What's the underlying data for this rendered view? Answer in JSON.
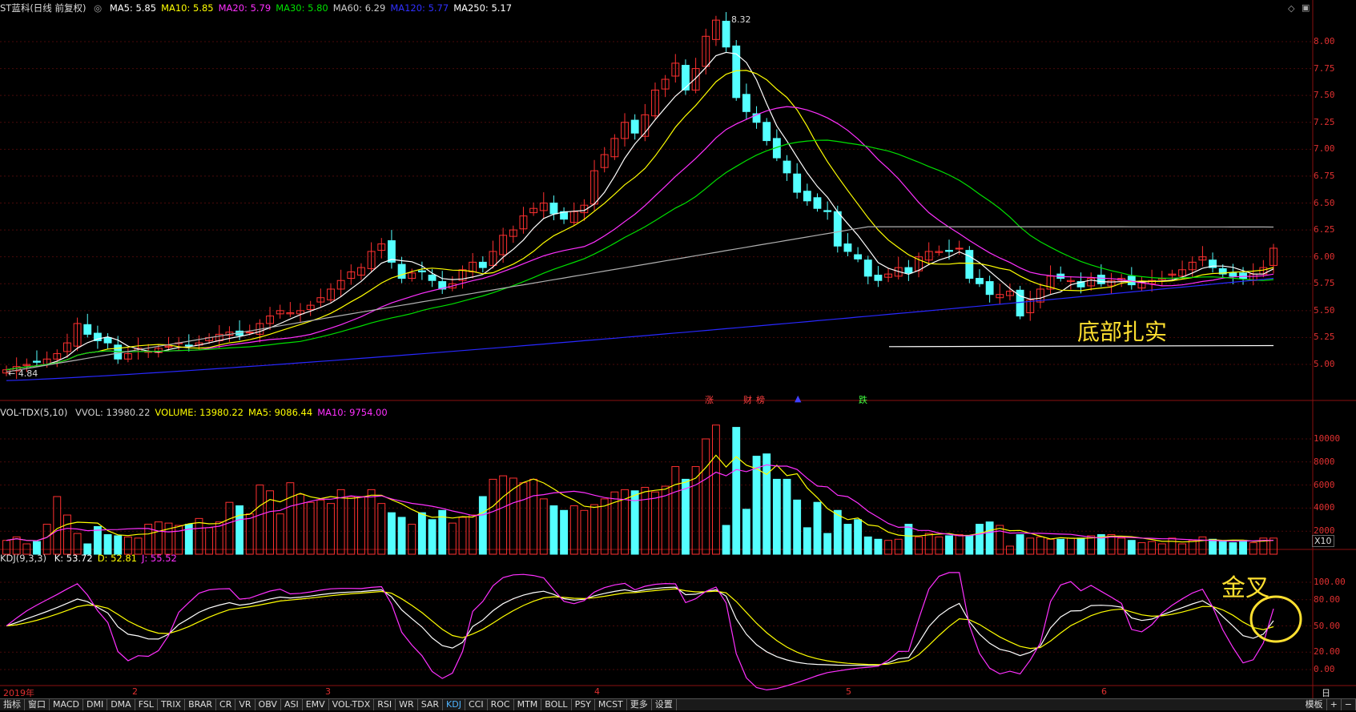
{
  "main": {
    "title": "ST蓝科(日线 前复权)",
    "ma": [
      {
        "label": "MA5: 5.85",
        "color": "#ffffff"
      },
      {
        "label": "MA10: 5.85",
        "color": "#ffff00"
      },
      {
        "label": "MA20: 5.79",
        "color": "#ff30ff"
      },
      {
        "label": "MA30: 5.80",
        "color": "#00e000"
      },
      {
        "label": "MA60: 6.29",
        "color": "#cccccc"
      },
      {
        "label": "MA120: 5.77",
        "color": "#3030ff"
      },
      {
        "label": "MA250: 5.17",
        "color": "#ffffff"
      }
    ],
    "high_label": "8.32",
    "low_label": "4.84",
    "yticks": [
      "8.00",
      "7.75",
      "7.50",
      "7.25",
      "7.00",
      "6.75",
      "6.50",
      "6.25",
      "6.00",
      "5.75",
      "5.50",
      "5.25",
      "5.00"
    ],
    "annotation": "底部扎实",
    "events": [
      {
        "text": "涨",
        "color": "#ff4040"
      },
      {
        "text": "财",
        "color": "#ff4040"
      },
      {
        "text": "榜",
        "color": "#ff4040"
      },
      {
        "text": "▲",
        "color": "#4040ff"
      },
      {
        "text": "跌",
        "color": "#40ff40"
      }
    ]
  },
  "volume": {
    "title": "VOL-TDX(5,10)",
    "items": [
      {
        "label": "VVOL: 13980.22",
        "color": "#cccccc"
      },
      {
        "label": "VOLUME: 13980.22",
        "color": "#ffff00"
      },
      {
        "label": "MA5: 9086.44",
        "color": "#ffff00"
      },
      {
        "label": "MA10: 9754.00",
        "color": "#ff30ff"
      }
    ],
    "yticks": [
      "10000",
      "8000",
      "6000",
      "4000",
      "2000"
    ],
    "unit": "X10"
  },
  "kdj": {
    "title": "KDJ(9,3,3)",
    "items": [
      {
        "label": "K: 53.72",
        "color": "#ffffff"
      },
      {
        "label": "D: 52.81",
        "color": "#ffff00"
      },
      {
        "label": "J: 55.52",
        "color": "#ff30ff"
      }
    ],
    "yticks": [
      "100.00",
      "80.00",
      "50.00",
      "20.00",
      "0.00"
    ],
    "annotation": "金叉"
  },
  "dates": [
    "2019年",
    "2",
    "3",
    "4",
    "5",
    "6"
  ],
  "right_header": "日线",
  "tabs": [
    "指标",
    "窗口",
    "MACD",
    "DMI",
    "DMA",
    "FSL",
    "TRIX",
    "BRAR",
    "CR",
    "VR",
    "OBV",
    "ASI",
    "EMV",
    "VOL-TDX",
    "RSI",
    "WR",
    "SAR",
    "KDJ",
    "CCI",
    "ROC",
    "MTM",
    "BOLL",
    "PSY",
    "MCST",
    "更多",
    "设置"
  ],
  "active_tab": "KDJ",
  "right_tabs": [
    "模板",
    "+",
    "−"
  ],
  "chart_data": {
    "type": "candlestick",
    "closes": [
      4.95,
      4.98,
      5.0,
      5.02,
      5.05,
      5.1,
      5.2,
      5.38,
      5.28,
      5.22,
      5.2,
      5.05,
      5.1,
      5.15,
      5.12,
      5.15,
      5.17,
      5.2,
      5.18,
      5.2,
      5.25,
      5.28,
      5.3,
      5.27,
      5.3,
      5.38,
      5.45,
      5.5,
      5.48,
      5.5,
      5.55,
      5.62,
      5.7,
      5.78,
      5.86,
      5.9,
      6.05,
      6.12,
      5.95,
      5.8,
      5.85,
      5.86,
      5.78,
      5.7,
      5.75,
      5.88,
      5.95,
      5.9,
      6.05,
      6.2,
      6.25,
      6.38,
      6.45,
      6.5,
      6.4,
      6.35,
      6.42,
      6.48,
      6.8,
      6.95,
      7.1,
      7.25,
      7.15,
      7.32,
      7.55,
      7.65,
      7.8,
      7.55,
      7.75,
      8.05,
      8.2,
      7.95,
      7.48,
      7.35,
      7.25,
      7.08,
      6.92,
      6.78,
      6.6,
      6.52,
      6.45,
      6.42,
      6.1,
      6.05,
      5.98,
      5.82,
      5.78,
      5.84,
      5.9,
      5.85,
      6.0,
      6.05,
      6.05,
      6.05,
      6.08,
      5.8,
      5.75,
      5.65,
      5.65,
      5.68,
      5.45,
      5.6,
      5.7,
      5.82,
      5.8,
      5.78,
      5.72,
      5.8,
      5.75,
      5.78,
      5.8,
      5.74,
      5.76,
      5.78,
      5.8,
      5.84,
      5.88,
      5.95,
      6.0,
      5.9,
      5.84,
      5.82,
      5.8,
      5.84,
      5.9,
      6.08
    ],
    "volumes": [
      1200,
      1500,
      900,
      1100,
      2600,
      5000,
      3400,
      1800,
      900,
      2400,
      1700,
      1600,
      1500,
      1400,
      2600,
      2800,
      2700,
      2500,
      2600,
      3100,
      2300,
      2800,
      4500,
      4200,
      3500,
      6000,
      5500,
      3500,
      6200,
      5200,
      4500,
      4700,
      4400,
      5600,
      5000,
      5000,
      5600,
      4400,
      3600,
      3200,
      2600,
      3600,
      3000,
      3800,
      2700,
      3200,
      3400,
      5000,
      6500,
      6800,
      6600,
      6200,
      6500,
      4800,
      4200,
      3800,
      4200,
      3800,
      4300,
      4800,
      5400,
      5600,
      5500,
      5800,
      5400,
      5900,
      7600,
      6500,
      7600,
      10000,
      11200,
      2500,
      11000,
      3900,
      8500,
      8700,
      6500,
      6500,
      4700,
      2300,
      4500,
      1800,
      3800,
      2600,
      3000,
      1500,
      1300,
      1200,
      1300,
      2600,
      1500,
      1800,
      1500,
      1600,
      1700,
      1600,
      2600,
      2800,
      2500,
      700,
      1700,
      1400,
      1500,
      1300,
      1300,
      1400,
      1400,
      1600,
      1700,
      1700,
      1400,
      1200,
      1000,
      1100,
      900,
      1400,
      900,
      1200,
      1500,
      1300,
      1100,
      1000,
      1200,
      1000,
      1400,
      1400
    ]
  }
}
